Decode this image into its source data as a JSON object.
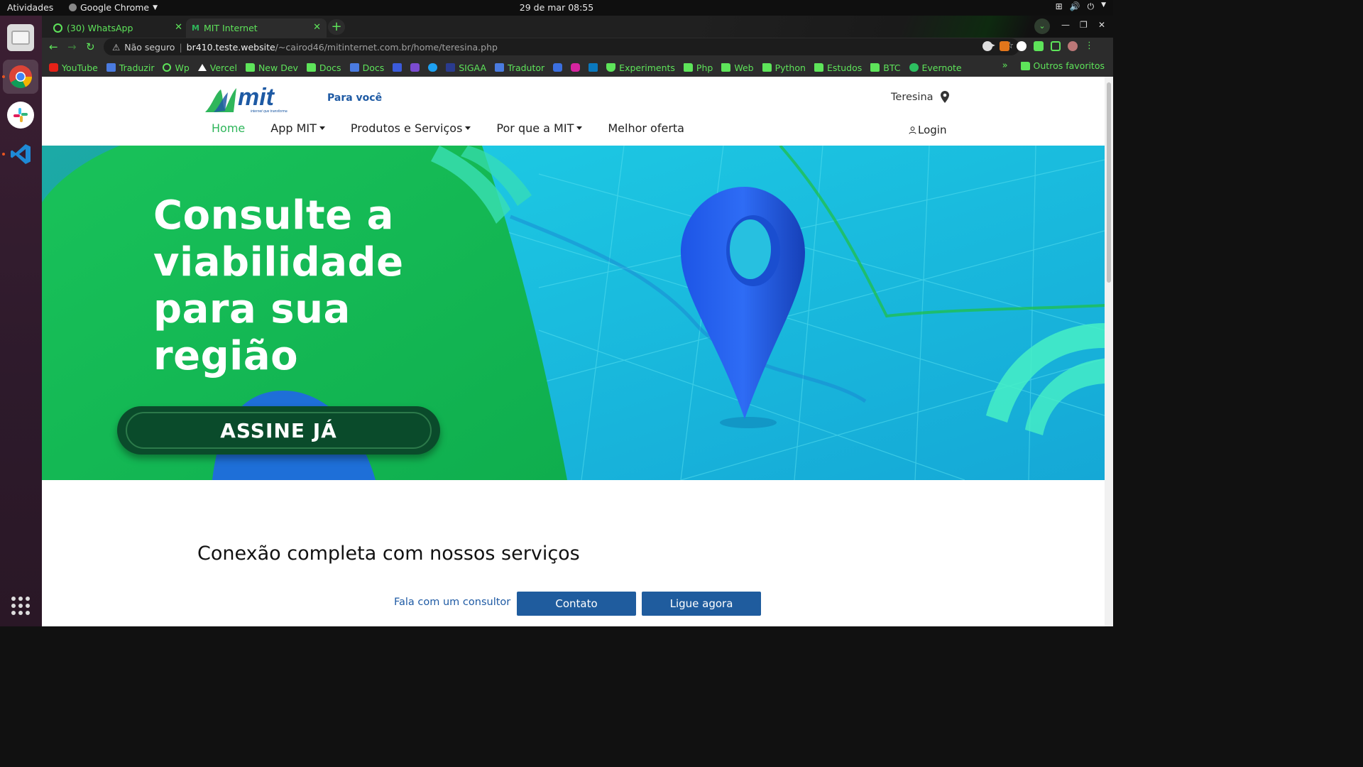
{
  "system": {
    "activities": "Atividades",
    "app_name": "Google Chrome",
    "clock": "29 de mar  08:55"
  },
  "browser": {
    "tabs": [
      {
        "title": "(30) WhatsApp",
        "active": false
      },
      {
        "title": "MIT Internet",
        "active": true
      }
    ],
    "security_label": "Não seguro",
    "url_host": "br410.teste.website",
    "url_path": "/~cairod46/mitinternet.com.br/home/teresina.php",
    "bookmarks": [
      {
        "label": "YouTube",
        "icon": "youtube-icon"
      },
      {
        "label": "Traduzir",
        "icon": "translate-icon"
      },
      {
        "label": "Wp",
        "icon": "whatsapp-icon"
      },
      {
        "label": "Vercel",
        "icon": "vercel-icon"
      },
      {
        "label": "New Dev",
        "icon": "folder-icon"
      },
      {
        "label": "Docs",
        "icon": "folder-icon"
      },
      {
        "label": "Docs",
        "icon": "docs-icon"
      },
      {
        "label": "",
        "icon": "facebook-icon"
      },
      {
        "label": "",
        "icon": "app-icon"
      },
      {
        "label": "",
        "icon": "twitter-icon"
      },
      {
        "label": "SIGAA",
        "icon": "sigaa-icon"
      },
      {
        "label": "Tradutor",
        "icon": "translate-icon"
      },
      {
        "label": "",
        "icon": "g-icon"
      },
      {
        "label": "",
        "icon": "instagram-icon"
      },
      {
        "label": "",
        "icon": "trello-icon"
      },
      {
        "label": "Experiments",
        "icon": "experiments-icon"
      },
      {
        "label": "Php",
        "icon": "folder-icon"
      },
      {
        "label": "Web",
        "icon": "folder-icon"
      },
      {
        "label": "Python",
        "icon": "folder-icon"
      },
      {
        "label": "Estudos",
        "icon": "folder-icon"
      },
      {
        "label": "BTC",
        "icon": "folder-icon"
      },
      {
        "label": "Evernote",
        "icon": "evernote-icon"
      }
    ],
    "more_bookmarks": "»",
    "other_favorites": "Outros favoritos",
    "accent": "#5ee45a"
  },
  "site": {
    "logo_text": "mit",
    "logo_tagline": "internet que transforma",
    "segment_link": "Para você",
    "city": "Teresina",
    "nav": [
      "Home",
      "App MIT",
      "Produtos e Serviços",
      "Por que a MIT",
      "Melhor oferta"
    ],
    "login": "Login",
    "hero": {
      "line1": "Consulte a",
      "line2": "viabilidade",
      "line3": "para sua",
      "line4": "região",
      "cta": "ASSINE JÁ"
    },
    "section_title": "Conexão completa com nossos serviços",
    "consultant_text": "Fala com um consultor",
    "contact_button": "Contato",
    "call_button": "Ligue agora",
    "colors": {
      "brand_blue": "#1f5c9e",
      "brand_green": "#2fb65b",
      "cta_dark": "#0a4b2b"
    }
  }
}
